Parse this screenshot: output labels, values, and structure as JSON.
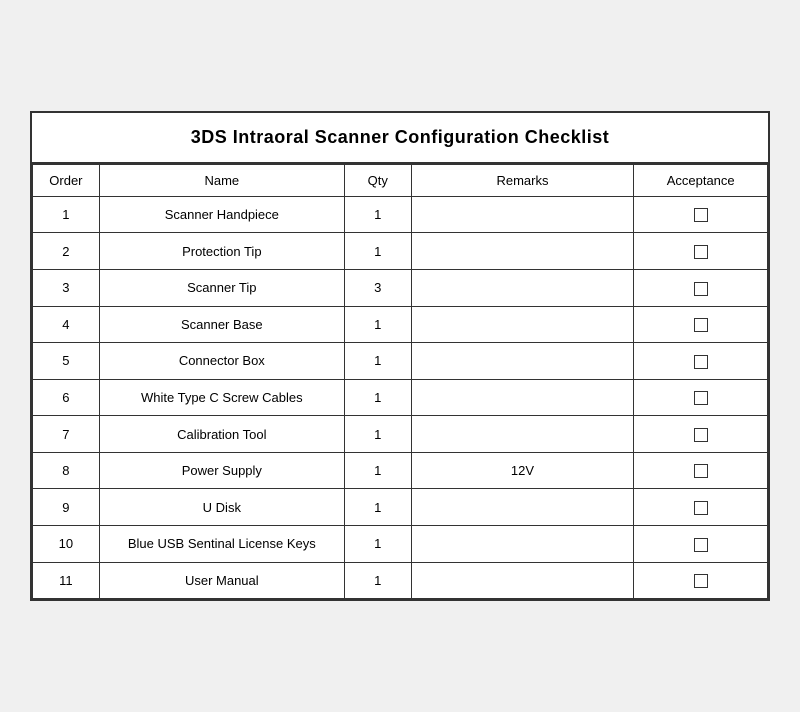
{
  "title": "3DS Intraoral Scanner Configuration Checklist",
  "headers": {
    "order": "Order",
    "name": "Name",
    "qty": "Qty",
    "remarks": "Remarks",
    "acceptance": "Acceptance"
  },
  "rows": [
    {
      "order": "1",
      "name": "Scanner Handpiece",
      "qty": "1",
      "remarks": "",
      "acceptance": ""
    },
    {
      "order": "2",
      "name": "Protection Tip",
      "qty": "1",
      "remarks": "",
      "acceptance": ""
    },
    {
      "order": "3",
      "name": "Scanner Tip",
      "qty": "3",
      "remarks": "",
      "acceptance": ""
    },
    {
      "order": "4",
      "name": "Scanner Base",
      "qty": "1",
      "remarks": "",
      "acceptance": ""
    },
    {
      "order": "5",
      "name": "Connector Box",
      "qty": "1",
      "remarks": "",
      "acceptance": ""
    },
    {
      "order": "6",
      "name": "White Type C Screw Cables",
      "qty": "1",
      "remarks": "",
      "acceptance": ""
    },
    {
      "order": "7",
      "name": "Calibration Tool",
      "qty": "1",
      "remarks": "",
      "acceptance": ""
    },
    {
      "order": "8",
      "name": "Power Supply",
      "qty": "1",
      "remarks": "12V",
      "acceptance": ""
    },
    {
      "order": "9",
      "name": "U Disk",
      "qty": "1",
      "remarks": "",
      "acceptance": ""
    },
    {
      "order": "10",
      "name": "Blue USB Sentinal License Keys",
      "qty": "1",
      "remarks": "",
      "acceptance": ""
    },
    {
      "order": "11",
      "name": "User Manual",
      "qty": "1",
      "remarks": "",
      "acceptance": ""
    }
  ]
}
